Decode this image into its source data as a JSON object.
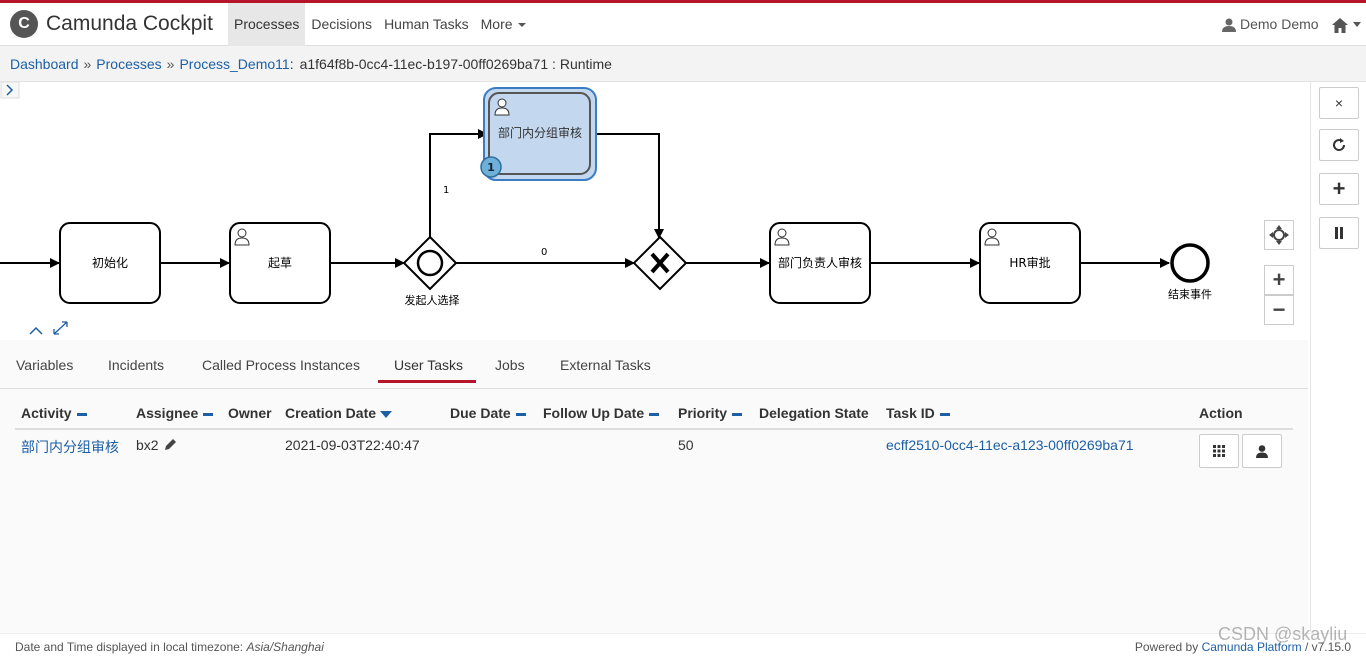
{
  "app": {
    "brand_letter": "C",
    "title": "Camunda Cockpit",
    "accent": "#b5152b"
  },
  "nav": {
    "items": [
      {
        "label": "Processes",
        "active": true
      },
      {
        "label": "Decisions",
        "active": false
      },
      {
        "label": "Human Tasks",
        "active": false
      },
      {
        "label": "More",
        "active": false
      }
    ],
    "user_label": "Demo Demo",
    "user_icon": "user-icon",
    "home_icon": "home-icon"
  },
  "breadcrumb": {
    "dashboard": "Dashboard",
    "processes": "Processes",
    "process": "Process_Demo11",
    "separator": "»",
    "colon": ":",
    "instance": "a1f64f8b-0cc4-11ec-b197-00ff0269ba71 : Runtime"
  },
  "diagram": {
    "tasks": {
      "init": "初始化",
      "draft": "起草",
      "dept_group_review": "部门内分组审核",
      "dept_head_review": "部门负责人审核",
      "hr_approve": "HR审批"
    },
    "gateway_label": "发起人选择",
    "end_label": "结束事件",
    "flow_labels": {
      "upper": "1",
      "lower": "0"
    },
    "token_count": "1",
    "controls": {
      "close": "×",
      "refresh_icon": "refresh-icon",
      "plus": "+",
      "pause_icon": "pause-icon",
      "zoom_in": "+",
      "zoom_out": "−"
    }
  },
  "tabs": [
    {
      "label": "Variables",
      "active": false
    },
    {
      "label": "Incidents",
      "active": false
    },
    {
      "label": "Called Process Instances",
      "active": false
    },
    {
      "label": "User Tasks",
      "active": true
    },
    {
      "label": "Jobs",
      "active": false
    },
    {
      "label": "External Tasks",
      "active": false
    }
  ],
  "table": {
    "headers": {
      "activity": "Activity",
      "assignee": "Assignee",
      "owner": "Owner",
      "creation_date": "Creation Date",
      "due_date": "Due Date",
      "follow_up_date": "Follow Up Date",
      "priority": "Priority",
      "delegation_state": "Delegation State",
      "task_id": "Task ID",
      "action": "Action"
    },
    "rows": [
      {
        "activity": "部门内分组审核",
        "assignee": "bx2",
        "owner": "",
        "creation_date": "2021-09-03T22:40:47",
        "due_date": "",
        "follow_up_date": "",
        "priority": "50",
        "delegation_state": "",
        "task_id": "ecff2510-0cc4-11ec-a123-00ff0269ba71"
      }
    ]
  },
  "footer": {
    "timezone_prefix": "Date and Time displayed in local timezone:",
    "timezone": "Asia/Shanghai",
    "powered_by": "Powered by",
    "platform": "Camunda Platform",
    "version": "/ v7.15.0"
  },
  "watermark": "CSDN @skayliu"
}
